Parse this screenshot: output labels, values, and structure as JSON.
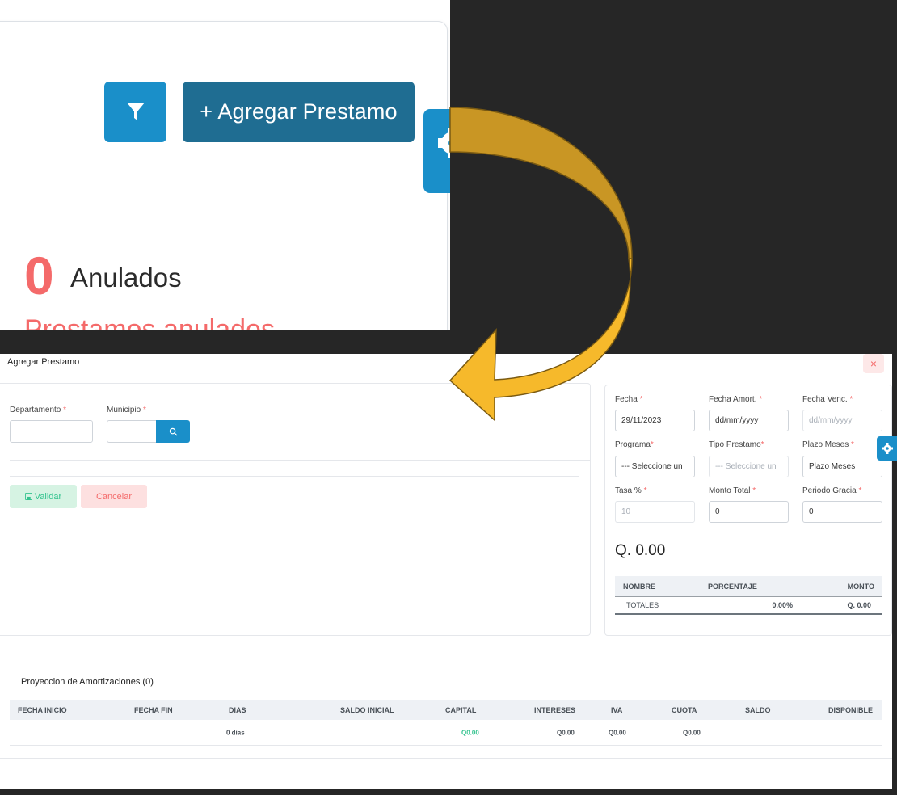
{
  "top": {
    "add_loan_label": "+ Agregar Prestamo",
    "void_count": "0",
    "void_label": "Anulados",
    "void_subtitle": "Prestamos anulados"
  },
  "modal": {
    "title": "Agregar Prestamo",
    "close": "×",
    "departamento": {
      "label": "Departamento",
      "req": "*",
      "value": ""
    },
    "municipio": {
      "label": "Municipio",
      "req": "*",
      "value": ""
    },
    "validar_label": "Validar",
    "cancelar_label": "Cancelar",
    "fecha": {
      "label": "Fecha",
      "req": "*",
      "value": "29/11/2023"
    },
    "fecha_amort": {
      "label": "Fecha Amort.",
      "req": "*",
      "value": "dd/mm/yyyy"
    },
    "fecha_venc": {
      "label": "Fecha Venc.",
      "req": "*",
      "value": "dd/mm/yyyy"
    },
    "programa": {
      "label": "Programa",
      "req": "*",
      "value": "--- Seleccione un"
    },
    "tipo_prestamo": {
      "label": "Tipo Prestamo",
      "req": "*",
      "value": "--- Seleccione un"
    },
    "plazo_meses": {
      "label": "Plazo Meses",
      "req": "*",
      "value": "Plazo Meses"
    },
    "tasa": {
      "label": "Tasa %",
      "req": "*",
      "value": "10"
    },
    "monto_total": {
      "label": "Monto Total",
      "req": "*",
      "value": "0"
    },
    "periodo_gracia": {
      "label": "Periodo Gracia",
      "req": "*",
      "value": "0"
    },
    "total_amount": "Q. 0.00",
    "summary_table": {
      "headers": [
        "NOMBRE",
        "PORCENTAJE",
        "MONTO"
      ],
      "row": [
        "TOTALES",
        "0.00%",
        "Q. 0.00"
      ]
    },
    "projection": {
      "title": "Proyeccion de Amortizaciones (0)",
      "headers": [
        "FECHA INICIO",
        "FECHA FIN",
        "DIAS",
        "SALDO INICIAL",
        "CAPITAL",
        "INTERESES",
        "IVA",
        "CUOTA",
        "SALDO",
        "DISPONIBLE"
      ],
      "row": {
        "dias": "0 dias",
        "capital": "Q0.00",
        "intereses": "Q0.00",
        "iva": "Q0.00",
        "cuota": "Q0.00"
      }
    }
  },
  "colors": {
    "primary": "#1a8fc9",
    "primary_dark": "#1f6d92",
    "danger": "#f46a6a",
    "success": "#34c38f",
    "arrow": "#f6b92b"
  },
  "icons": [
    "filter-icon",
    "gear-icon",
    "search-icon",
    "save-icon",
    "curved-arrow"
  ]
}
